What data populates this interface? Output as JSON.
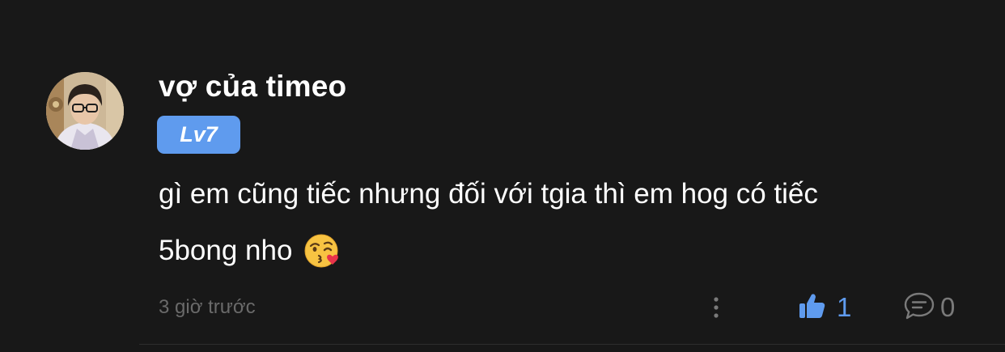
{
  "comment": {
    "username": "vợ của timeo",
    "level_badge": "Lv7",
    "text_line_1": "gì em cũng tiếc nhưng đối với tgia thì em hog có tiếc",
    "text_line_2": "5bong nho",
    "emoji": "face-blowing-a-kiss",
    "timestamp": "3 giờ trước",
    "likes": "1",
    "replies": "0"
  },
  "colors": {
    "background": "#181818",
    "accent": "#5f9bee",
    "muted_text": "#6a6a6a"
  }
}
